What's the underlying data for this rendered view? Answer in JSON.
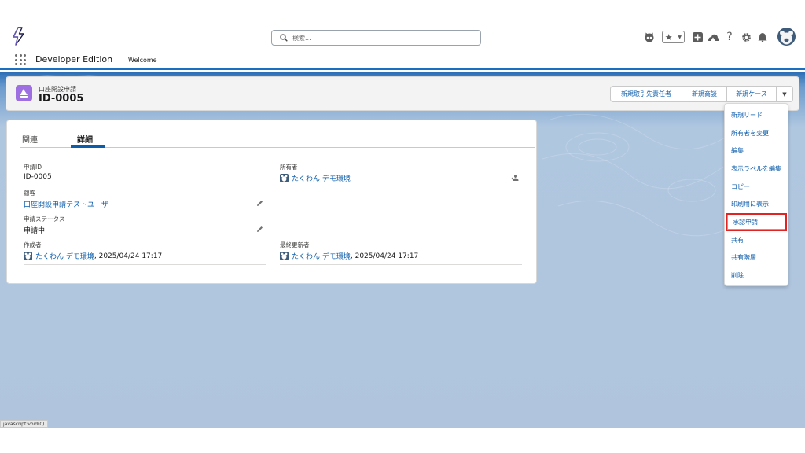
{
  "header": {
    "search_placeholder": "検索...",
    "app_name": "Developer Edition",
    "nav_tab": "Welcome"
  },
  "record": {
    "object_type": "口座開設申請",
    "title": "ID-0005",
    "actions": [
      "新規取引先責任者",
      "新規商談",
      "新規ケース"
    ]
  },
  "menu": {
    "items": [
      "新規リード",
      "所有者を変更",
      "編集",
      "表示ラベルを編集",
      "コピー",
      "印刷用に表示",
      "承認申請",
      "共有",
      "共有階層",
      "削除"
    ]
  },
  "tabs": [
    "関連",
    "詳細"
  ],
  "fields": {
    "app_id": {
      "label": "申請ID",
      "value": "ID-0005"
    },
    "owner": {
      "label": "所有者",
      "value": "たくわん デモ環境"
    },
    "customer": {
      "label": "顧客",
      "value": "口座開設申請テストユーザ"
    },
    "status": {
      "label": "申請ステータス",
      "value": "申請中"
    },
    "created_by": {
      "label": "作成者",
      "name": "たくわん デモ環境",
      "date": ", 2025/04/24 17:17"
    },
    "modified_by": {
      "label": "最終更新者",
      "name": "たくわん デモ環境",
      "date": ", 2025/04/24 17:17"
    }
  },
  "status_bar": "javascript:void(0)",
  "colors": {
    "brand": "#0b5cab",
    "object_icon": "#9e6fe0",
    "highlight": "#e02424"
  }
}
